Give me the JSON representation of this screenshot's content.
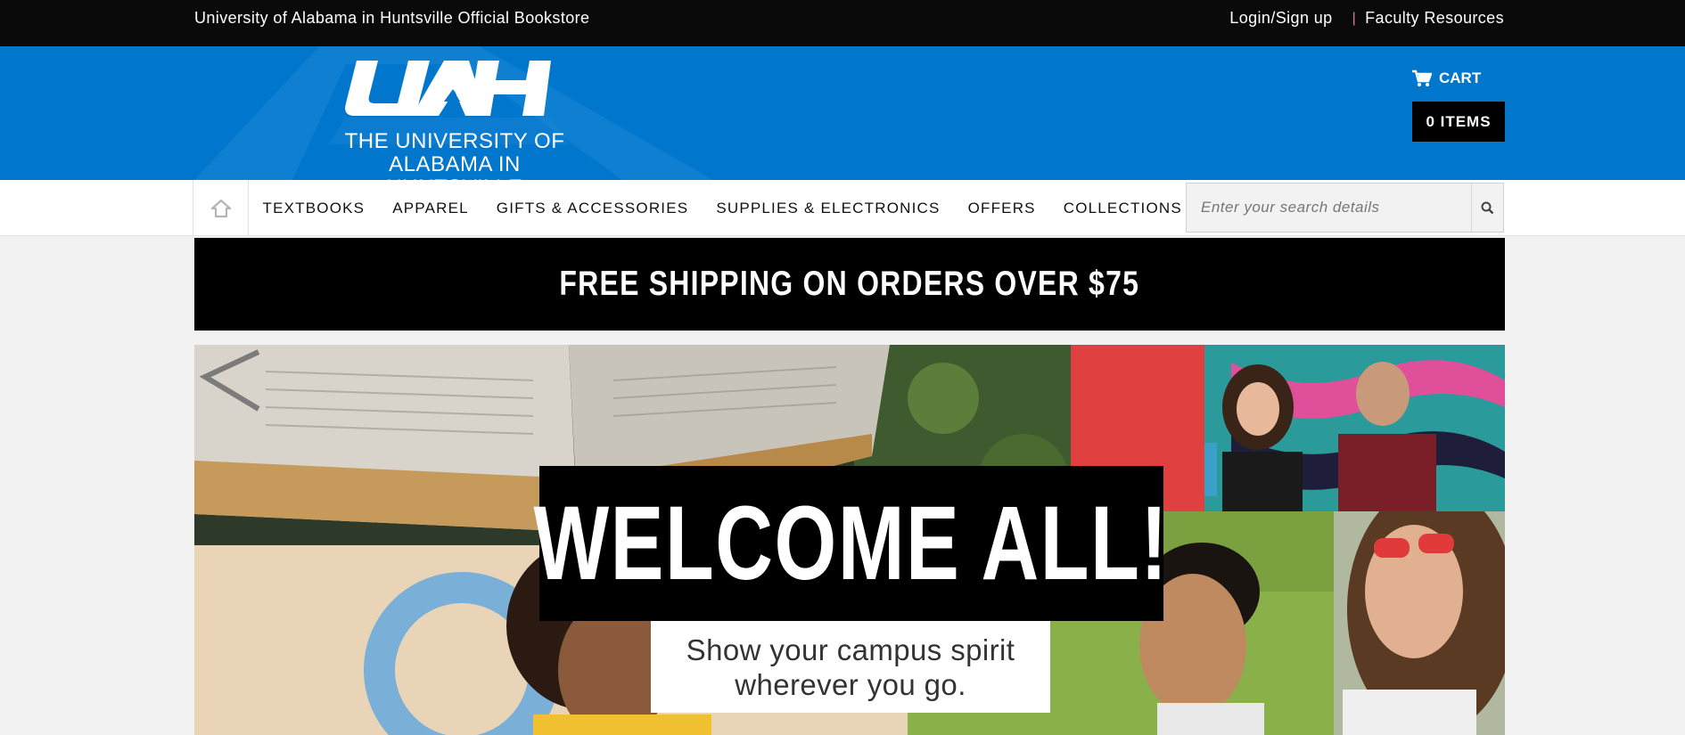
{
  "topbar": {
    "store_name": "University of Alabama in Huntsville Official Bookstore",
    "login_label": "Login/Sign up",
    "separator": "|",
    "faculty_label": "Faculty Resources"
  },
  "header": {
    "logo_line1": "THE UNIVERSITY OF",
    "logo_line2": "ALABAMA IN HUNTSVILLE",
    "cart_label": "CART",
    "cart_items": "0 ITEMS"
  },
  "nav": {
    "items": [
      "TEXTBOOKS",
      "APPAREL",
      "GIFTS & ACCESSORIES",
      "SUPPLIES & ELECTRONICS",
      "OFFERS",
      "COLLECTIONS"
    ]
  },
  "search": {
    "placeholder": "Enter your search details"
  },
  "promo": {
    "text": "FREE SHIPPING ON ORDERS OVER $75"
  },
  "hero": {
    "headline": "WELCOME ALL!",
    "tagline_line1": "Show your campus spirit",
    "tagline_line2": "wherever you go."
  },
  "colors": {
    "header_blue": "#0076cc",
    "topbar_black": "#0a0a0a",
    "separator_pink": "#e07a9a"
  },
  "icons": [
    "cart-icon",
    "home-icon",
    "search-icon",
    "chevron-left-icon"
  ]
}
